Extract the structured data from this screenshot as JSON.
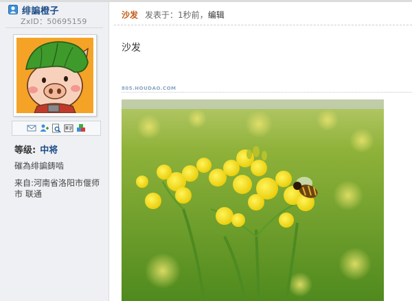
{
  "sidebar": {
    "username": "绯諞橙子",
    "zxid": "ZxID：50695159",
    "rank_label": "等级:",
    "rank_value": "中将",
    "bio": "磪為绯諞鋳啮",
    "location": "来自:河南省洛阳市偃师市 联通",
    "actions": [
      "message-icon",
      "add-friend-icon",
      "search-icon",
      "profile-card-icon",
      "blocks-icon"
    ]
  },
  "post": {
    "title": "沙发",
    "posted_prefix": "发表于：",
    "time": "1秒前",
    "separator": "，",
    "edit": "编辑",
    "body": "沙发",
    "watermark": "805.HOUDAO.COM"
  },
  "colors": {
    "sidebar_bg": "#eef0f3",
    "username": "#1c4c86",
    "title": "#c25b17"
  }
}
